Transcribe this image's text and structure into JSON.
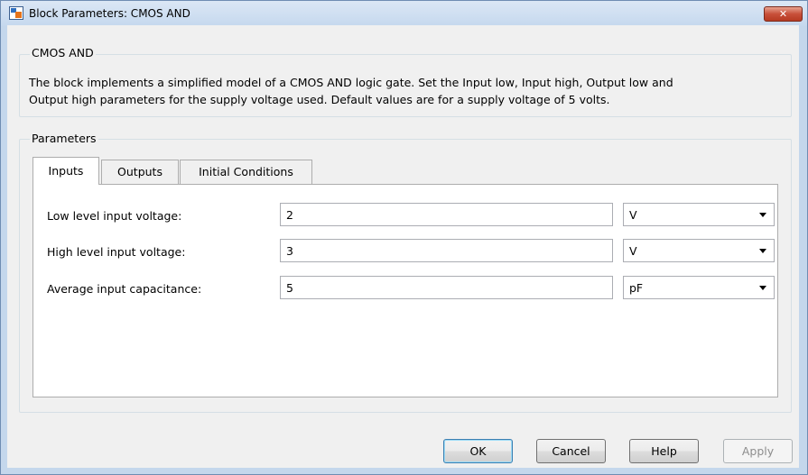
{
  "window": {
    "title": "Block Parameters: CMOS AND",
    "close_label": "✕"
  },
  "block": {
    "name": "CMOS AND",
    "description_line1": "The block implements a simplified model of a CMOS AND logic gate. Set the Input low, Input high, Output low and",
    "description_line2": "Output high parameters for the supply voltage used. Default values are for a supply voltage of 5 volts."
  },
  "parameters": {
    "group_label": "Parameters",
    "tabs": [
      {
        "label": "Inputs",
        "active": true
      },
      {
        "label": "Outputs",
        "active": false
      },
      {
        "label": "Initial Conditions",
        "active": false
      }
    ],
    "rows": [
      {
        "label": "Low level input voltage:",
        "value": "2",
        "unit": "V"
      },
      {
        "label": "High level input voltage:",
        "value": "3",
        "unit": "V"
      },
      {
        "label": "Average input capacitance:",
        "value": "5",
        "unit": "pF"
      }
    ]
  },
  "buttons": {
    "ok": "OK",
    "cancel": "Cancel",
    "help": "Help",
    "apply": "Apply"
  }
}
